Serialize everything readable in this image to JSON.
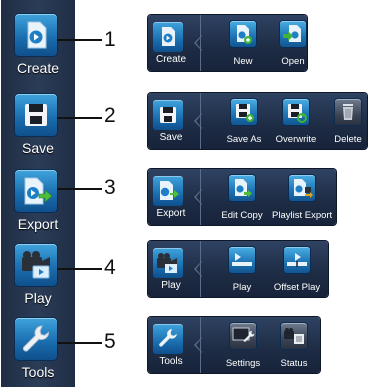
{
  "toolbar": {
    "items": [
      {
        "label": "Create",
        "icon": "create-icon",
        "number": "1"
      },
      {
        "label": "Save",
        "icon": "save-icon",
        "number": "2"
      },
      {
        "label": "Export",
        "icon": "export-icon",
        "number": "3"
      },
      {
        "label": "Play",
        "icon": "play-icon",
        "number": "4"
      },
      {
        "label": "Tools",
        "icon": "tools-icon",
        "number": "5"
      }
    ]
  },
  "panels": {
    "create": {
      "label": "Create",
      "options": [
        "New",
        "Open"
      ]
    },
    "save": {
      "label": "Save",
      "options": [
        "Save As",
        "Overwrite",
        "Delete"
      ]
    },
    "export": {
      "label": "Export",
      "options": [
        "Edit Copy",
        "Playlist Export"
      ]
    },
    "play": {
      "label": "Play",
      "options": [
        "Play",
        "Offset Play"
      ]
    },
    "tools": {
      "label": "Tools",
      "options": [
        "Settings",
        "Status"
      ]
    }
  },
  "colors": {
    "toolbar_bg": "#26354d",
    "tile_blue": "#1b6fb0",
    "callout": "#111111"
  }
}
